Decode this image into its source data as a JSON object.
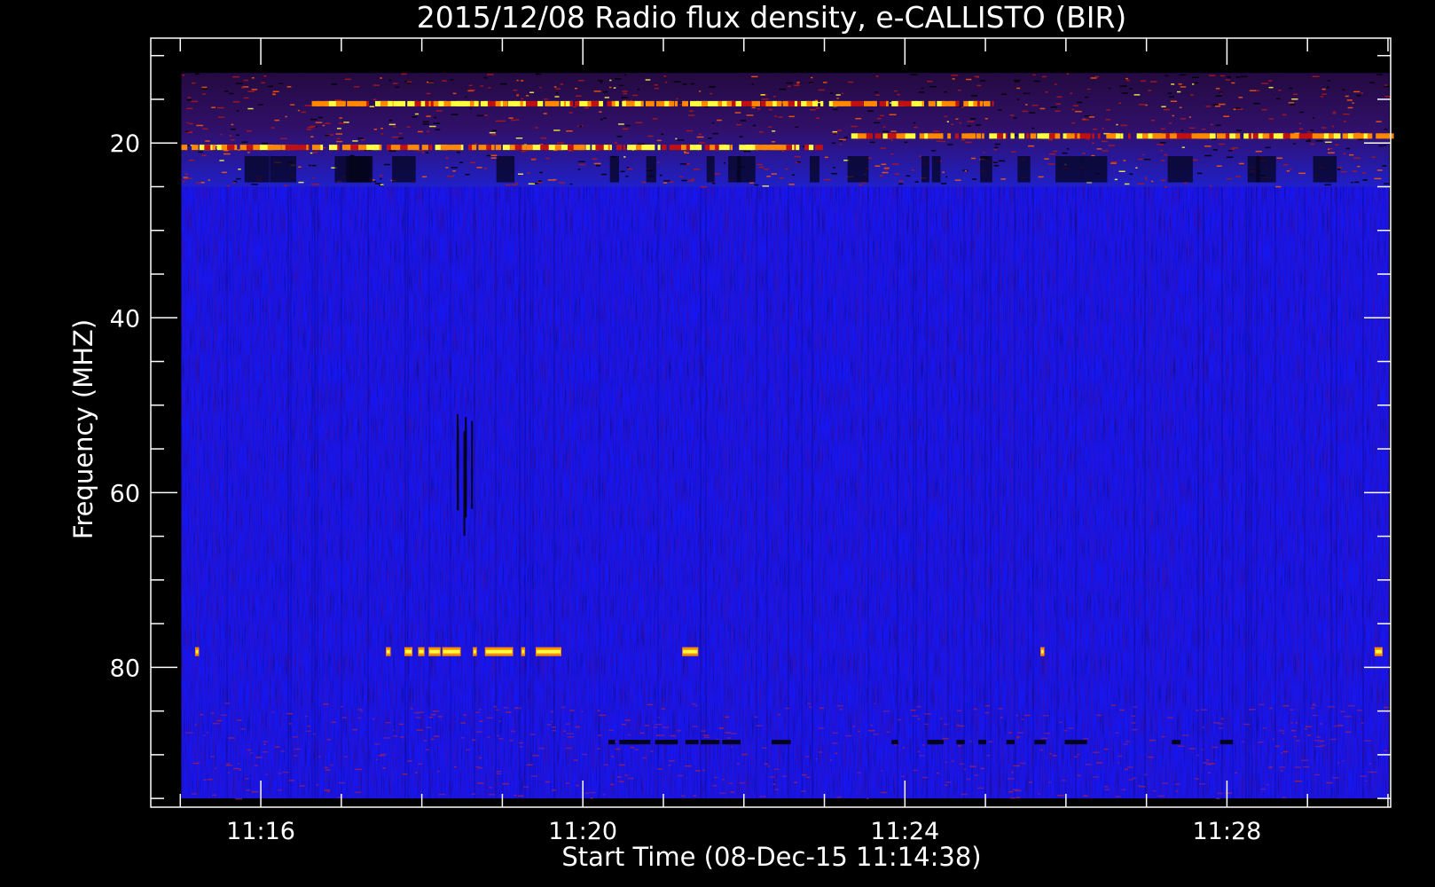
{
  "chart_data": {
    "type": "heatmap",
    "title": "2015/12/08  Radio flux density, e-CALLISTO (BIR)",
    "xlabel": "Start Time (08-Dec-15 11:14:38)",
    "ylabel": "Frequency (MHZ)",
    "x_start": "11:14:38",
    "x_range_minutes": [
      0,
      15.4
    ],
    "x_ticks": [
      {
        "label": "11:16",
        "minute": 1.3667
      },
      {
        "label": "11:20",
        "minute": 5.3667
      },
      {
        "label": "11:24",
        "minute": 9.3667
      },
      {
        "label": "11:28",
        "minute": 13.3667
      }
    ],
    "y_range": [
      96,
      8
    ],
    "y_ticks": [
      20,
      40,
      60,
      80
    ],
    "y_minor_step": 5,
    "x_minor_step_minutes": 1,
    "data_x_range_minutes": [
      0.38,
      15.38
    ],
    "data_y_range": [
      12,
      95
    ],
    "colors": {
      "background": "#000000",
      "axis": "#ffffff",
      "base": "#1616f0",
      "burst": "#ff8800",
      "hot": "#ffff40"
    },
    "features": [
      {
        "name": "interference band",
        "freq": [
          12,
          25
        ],
        "minute_range": [
          0.38,
          15.38
        ]
      },
      {
        "name": "bright line",
        "freq": 15.5,
        "minute_range": [
          2.0,
          10.5
        ]
      },
      {
        "name": "bright line",
        "freq": 19.2,
        "minute_range": [
          8.7,
          15.38
        ]
      },
      {
        "name": "bright line",
        "freq": 20.5,
        "minute_range": [
          0.38,
          8.3
        ]
      },
      {
        "name": "flashes",
        "freq": 78.2,
        "minute_range": [
          2.9,
          7.1
        ]
      },
      {
        "name": "dark spikes",
        "freq": [
          51,
          63
        ],
        "minute_range": [
          3.7,
          4.0
        ]
      }
    ]
  }
}
